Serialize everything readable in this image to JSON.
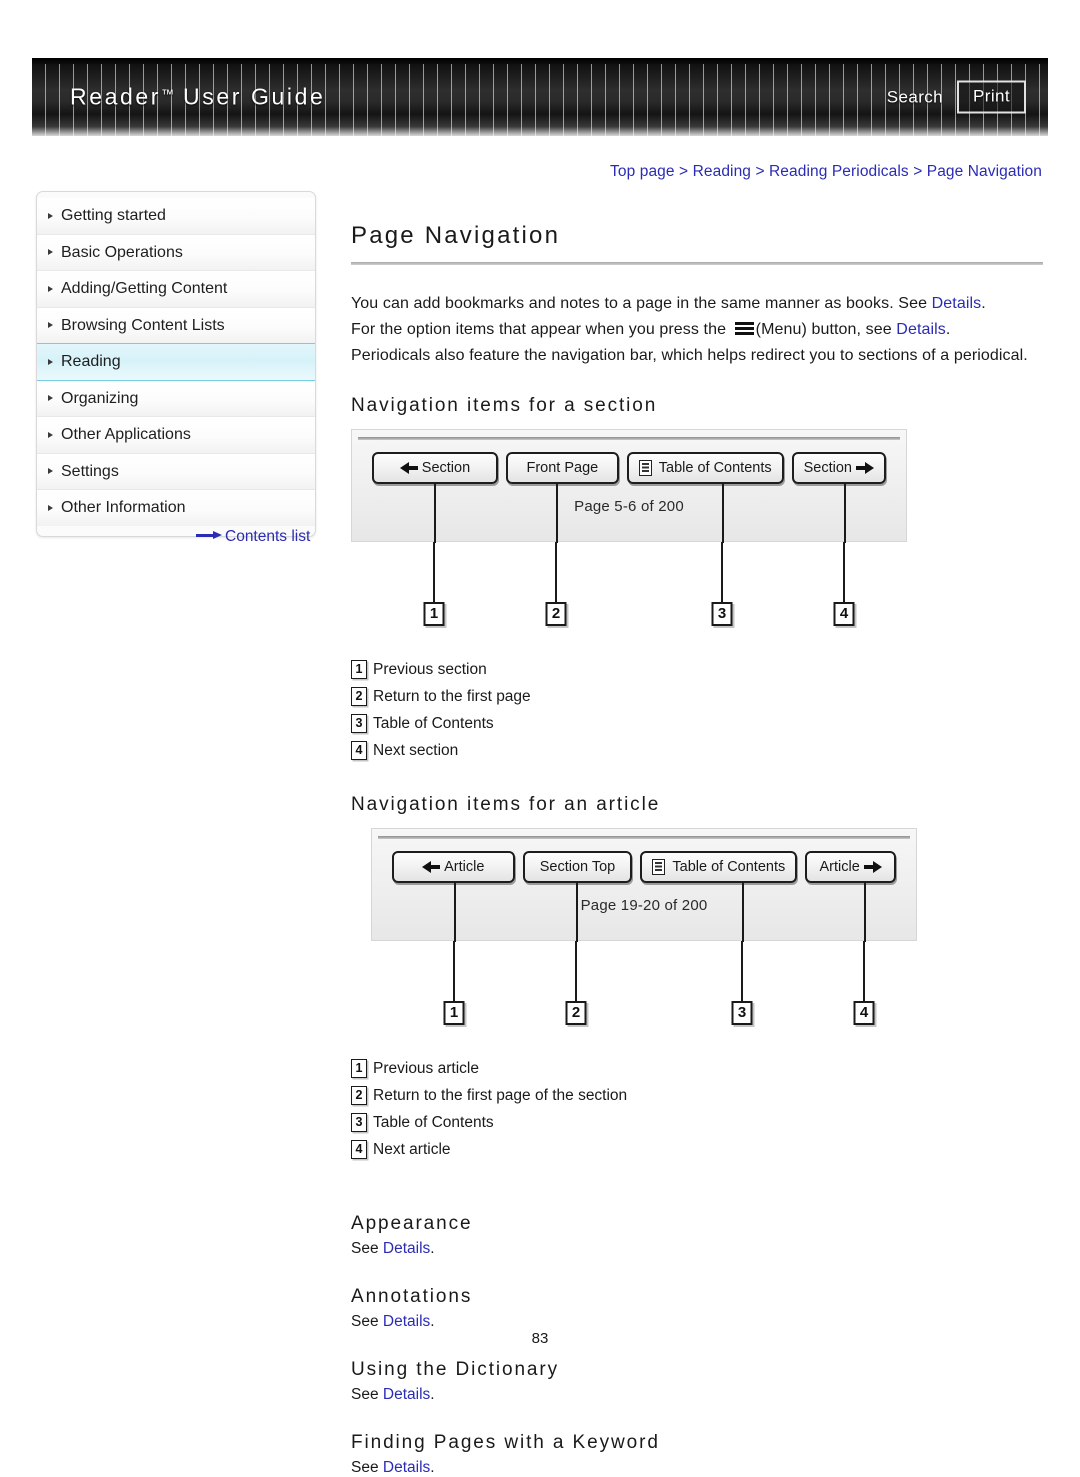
{
  "header": {
    "title": "Reader",
    "title_tm": "™",
    "title_rest": "User Guide",
    "search_label": "Search",
    "print_label": "Print"
  },
  "breadcrumb": {
    "items": [
      "Top page",
      "Reading",
      "Reading Periodicals",
      "Page Navigation"
    ],
    "separator": ">"
  },
  "sidebar": {
    "items": [
      {
        "label": "Getting started",
        "active": false
      },
      {
        "label": "Basic Operations",
        "active": false
      },
      {
        "label": "Adding/Getting Content",
        "active": false
      },
      {
        "label": "Browsing Content Lists",
        "active": false
      },
      {
        "label": "Reading",
        "active": true
      },
      {
        "label": "Organizing",
        "active": false
      },
      {
        "label": "Other Applications",
        "active": false
      },
      {
        "label": "Settings",
        "active": false
      },
      {
        "label": "Other Information",
        "active": false
      }
    ],
    "contents_list_label": "Contents list"
  },
  "main": {
    "page_title": "Page Navigation",
    "intro": {
      "line1_before": "You can add bookmarks and notes to a page in the same manner as books. See ",
      "line1_link": "Details",
      "line1_after": ".",
      "line2_before": "For the option items that appear when you press the ",
      "line2_mid": "(Menu) button, see ",
      "line2_link": "Details",
      "line2_after": ".",
      "line3": "Periodicals also feature the navigation bar, which helps redirect you to sections of a periodical."
    },
    "section_block": {
      "heading": "Navigation items for a section",
      "buttons": [
        {
          "label": "Section",
          "icon": "arrow-left-icon"
        },
        {
          "label": "Front Page",
          "icon": "none"
        },
        {
          "label": "Table of Contents",
          "icon": "toc-icon"
        },
        {
          "label": "Section",
          "icon": "arrow-right-icon"
        }
      ],
      "page_indicator": "Page 5-6 of 200",
      "callouts": [
        "1",
        "2",
        "3",
        "4"
      ],
      "legend": [
        {
          "num": "1",
          "text": "Previous section"
        },
        {
          "num": "2",
          "text": "Return to the first page"
        },
        {
          "num": "3",
          "text": "Table of Contents"
        },
        {
          "num": "4",
          "text": "Next section"
        }
      ]
    },
    "article_block": {
      "heading": "Navigation items for an article",
      "buttons": [
        {
          "label": "Article",
          "icon": "arrow-left-icon"
        },
        {
          "label": "Section Top",
          "icon": "none"
        },
        {
          "label": "Table of Contents",
          "icon": "toc-icon"
        },
        {
          "label": "Article",
          "icon": "arrow-right-icon"
        }
      ],
      "page_indicator": "Page 19-20 of 200",
      "callouts": [
        "1",
        "2",
        "3",
        "4"
      ],
      "legend": [
        {
          "num": "1",
          "text": "Previous article"
        },
        {
          "num": "2",
          "text": "Return to the first page of the section"
        },
        {
          "num": "3",
          "text": "Table of Contents"
        },
        {
          "num": "4",
          "text": "Next article"
        }
      ]
    },
    "tail_sections": [
      {
        "heading": "Appearance",
        "see_before": "See ",
        "link": "Details",
        "see_after": "."
      },
      {
        "heading": "Annotations",
        "see_before": "See ",
        "link": "Details",
        "see_after": "."
      },
      {
        "heading": "Using the Dictionary",
        "see_before": "See ",
        "link": "Details",
        "see_after": "."
      },
      {
        "heading": "Finding Pages with a Keyword",
        "see_before": "See ",
        "link": "Details",
        "see_after": "."
      }
    ]
  },
  "footer": {
    "page_number": "83"
  },
  "colors": {
    "link": "#2b2bb5",
    "header_bg": "#141414",
    "active_item": "#d7f2f9",
    "active_border": "#74cfe0"
  }
}
